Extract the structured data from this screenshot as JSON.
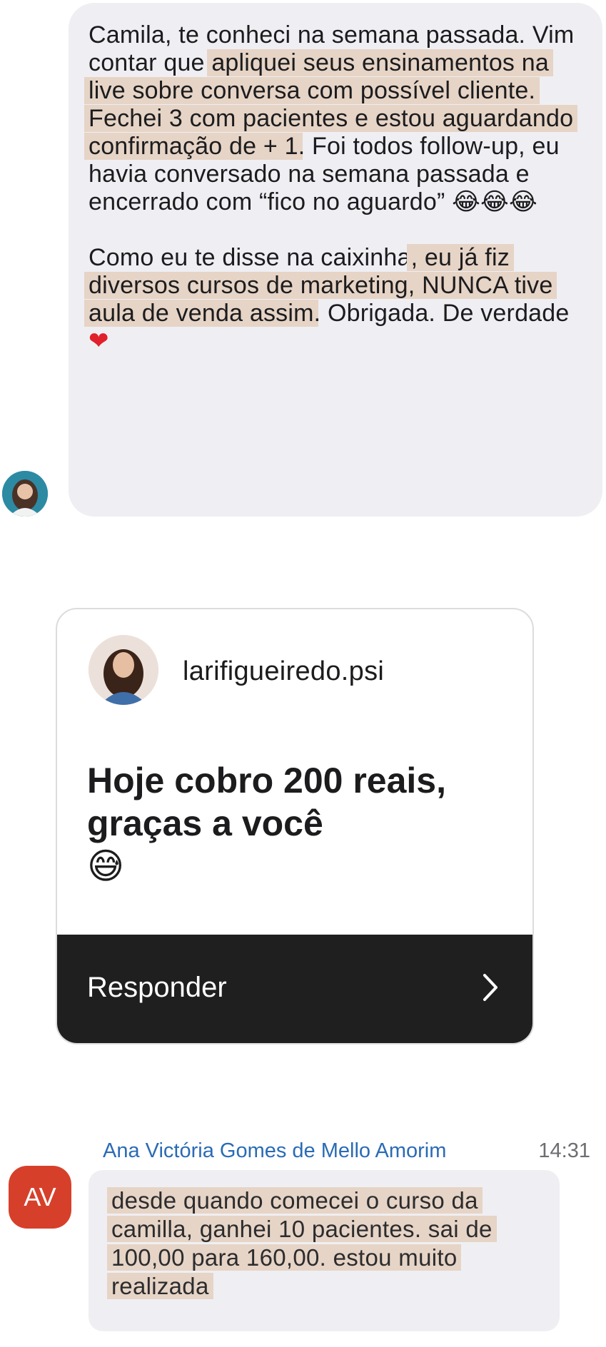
{
  "message_1": {
    "p1_plain_a": "Camila, te conheci na semana passada. Vim contar que ",
    "p1_highlight": "apliquei seus ensinamentos na live sobre conversa com possível cliente. Fechei 3 com pacientes e estou aguardando confirmação de + 1",
    "p1_plain_b": ". Foi todos follow-up, eu havia conversado na semana passada e encerrado com “fico no aguardo” ",
    "p1_emojis": "😂😂😂",
    "p2_plain_a": "Como eu te disse na caixinha",
    "p2_highlight": ", eu já fiz diversos cursos de marketing, NUNCA tive aula de venda assim",
    "p2_plain_b": ". Obrigada. De verdade ",
    "p2_emoji": "❤"
  },
  "story_card": {
    "handle": "larifigueiredo.psi",
    "text": "Hoje cobro 200 reais, graças a você",
    "emoji": "😅",
    "reply_label": "Responder",
    "chevron_icon": "chevron-right-icon"
  },
  "message_2": {
    "avatar_initials": "AV",
    "sender": "Ana Victória Gomes de Mello Amorim",
    "time": "14:31",
    "text": "desde quando comecei o curso da camilla, ganhei 10 pacientes. sai de 100,00 para 160,00. estou muito realizada"
  },
  "colors": {
    "bubble": "#efeff3",
    "highlight": "#e6d4c6",
    "sender_link": "#2a6bb5",
    "avatar_bg": "#d6402b",
    "card_footer": "#1f1f1f"
  }
}
